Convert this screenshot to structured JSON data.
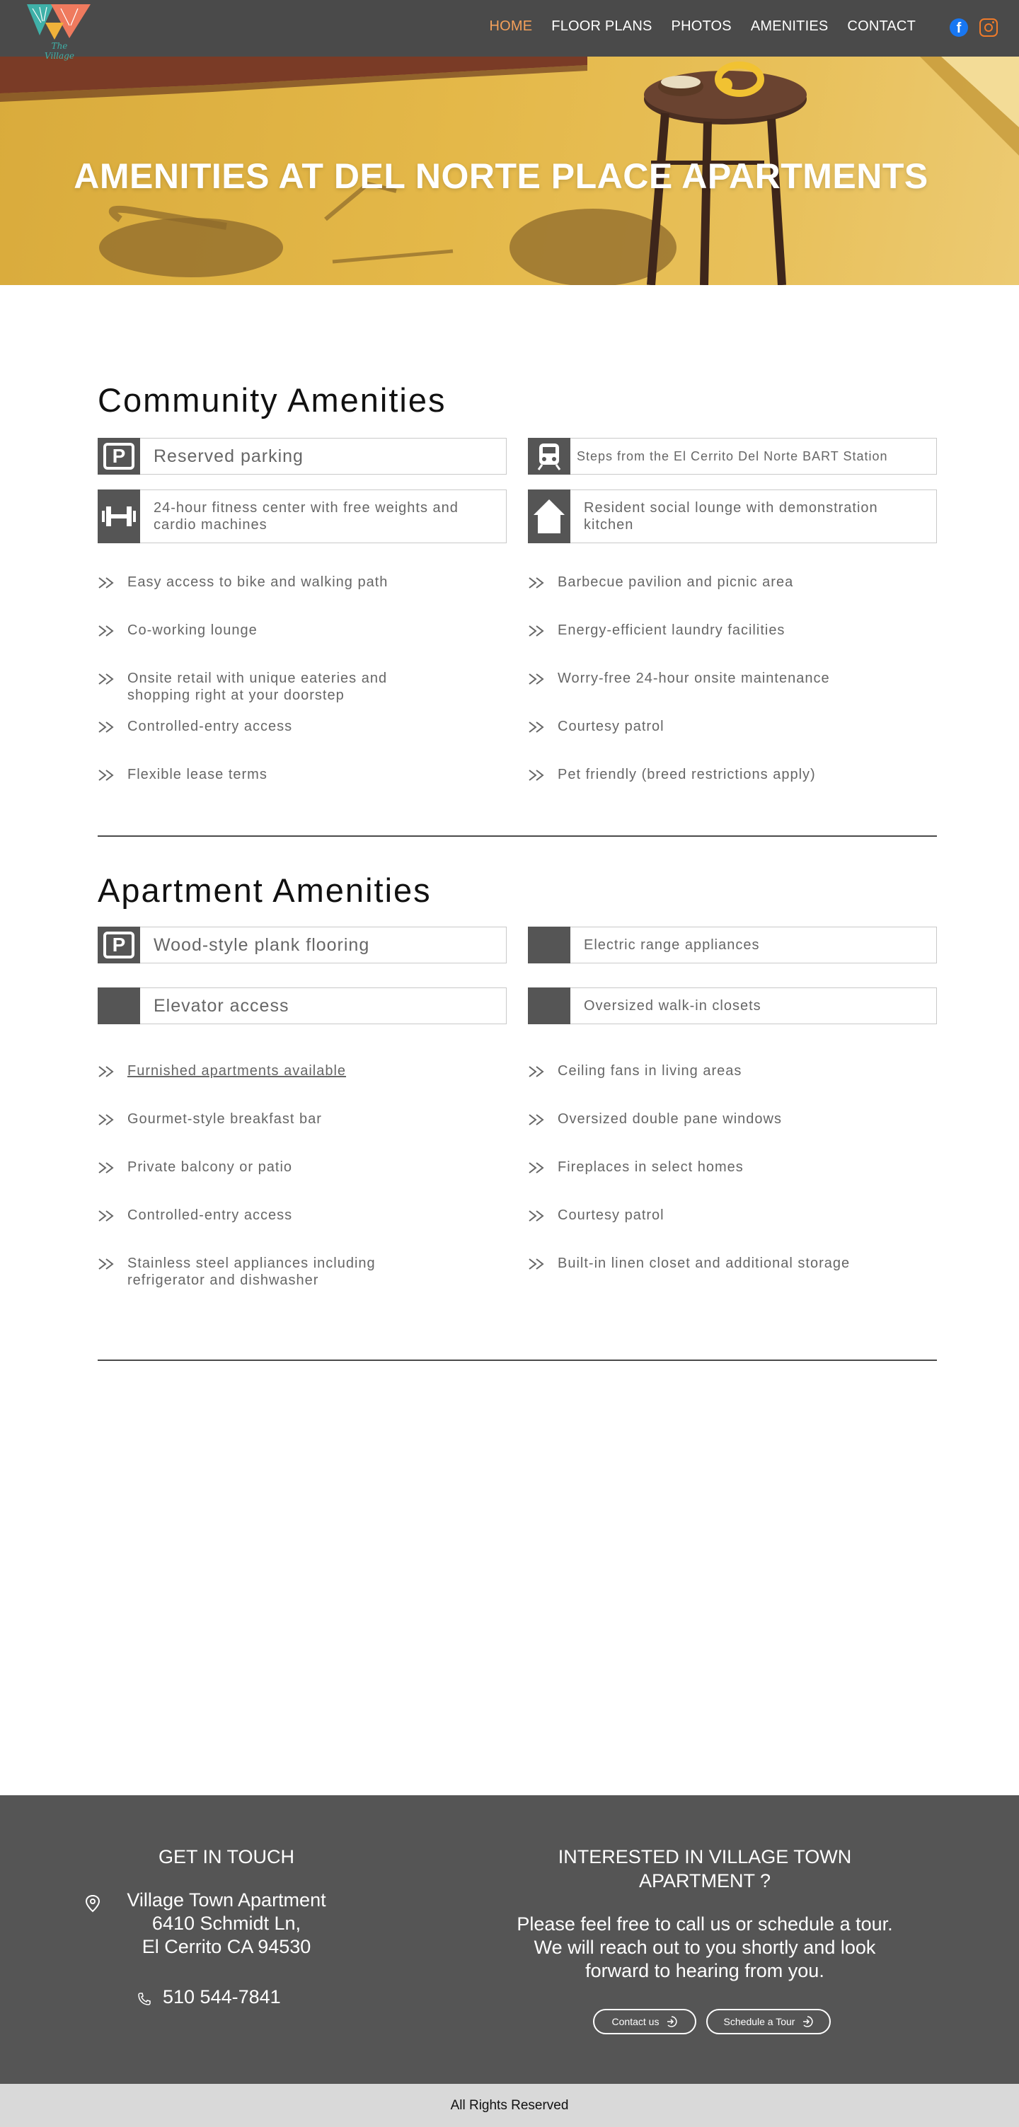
{
  "brand": {
    "logo_text": "The Village"
  },
  "nav": {
    "items": [
      {
        "label": "HOME",
        "active": true
      },
      {
        "label": "FLOOR PLANS",
        "active": false
      },
      {
        "label": "PHOTOS",
        "active": false
      },
      {
        "label": "AMENITIES",
        "active": false
      },
      {
        "label": "CONTACT",
        "active": false
      }
    ],
    "social": [
      "facebook-icon",
      "instagram-icon"
    ]
  },
  "hero": {
    "title": "AMENITIES AT DEL NORTE PLACE APARTMENTS"
  },
  "community": {
    "title": "Community Amenities",
    "features": [
      {
        "label": "Reserved parking",
        "icon": "parking-icon"
      },
      {
        "label": "Steps from the El Cerrito Del Norte BART Station",
        "icon": "train-icon"
      },
      {
        "label": "24-hour fitness center with free weights and cardio machines",
        "icon": "dumbbell-icon"
      },
      {
        "label": "Resident social lounge with demonstration kitchen",
        "icon": "house-icon"
      }
    ],
    "list_left": [
      "Easy access to bike and walking path",
      "Co-working lounge",
      "Onsite retail with unique eateries and shopping right at your doorstep",
      "Controlled-entry access",
      "Flexible lease terms"
    ],
    "list_right": [
      "Barbecue pavilion and picnic area",
      "Energy-efficient laundry facilities",
      "Worry-free 24-hour onsite maintenance",
      "Courtesy patrol",
      "Pet friendly (breed restrictions apply)"
    ]
  },
  "apartment": {
    "title": "Apartment Amenities",
    "features": [
      {
        "label": "Wood-style plank flooring",
        "icon": "parking-icon"
      },
      {
        "label": "Electric range appliances",
        "icon": ""
      },
      {
        "label": "Elevator access",
        "icon": ""
      },
      {
        "label": "Oversized walk-in closets",
        "icon": ""
      }
    ],
    "list_left": [
      "Furnished apartments available",
      "Gourmet-style breakfast bar",
      "Private balcony or patio",
      "Controlled-entry access",
      "Stainless steel appliances including  refrigerator and dishwasher"
    ],
    "list_right": [
      "Ceiling fans in living areas",
      "Oversized double pane windows",
      "Fireplaces in select homes",
      "Courtesy patrol",
      "Built-in linen closet and additional storage"
    ]
  },
  "footer": {
    "contact_heading": "GET IN TOUCH",
    "address_name": "Village Town Apartment",
    "address_line1": "6410 Schmidt Ln,",
    "address_line2": "El Cerrito CA 94530",
    "phone": "510 544-7841",
    "interest_heading": "INTERESTED IN VILLAGE TOWN APARTMENT ?",
    "interest_body": "Please feel free to call us or schedule a tour. We will reach out to you shortly and look forward to hearing from you.",
    "contact_button": "Contact us",
    "tour_button": "Schedule a Tour",
    "copyright": "All Rights Reserved"
  },
  "colors": {
    "nav_bg": "#4a4a4a",
    "nav_active": "#f4a05a",
    "hero_bg": "#e4b849",
    "icon_bg": "#555555",
    "footer_bg": "#555555",
    "bottom_bar": "#d9d9d9"
  }
}
